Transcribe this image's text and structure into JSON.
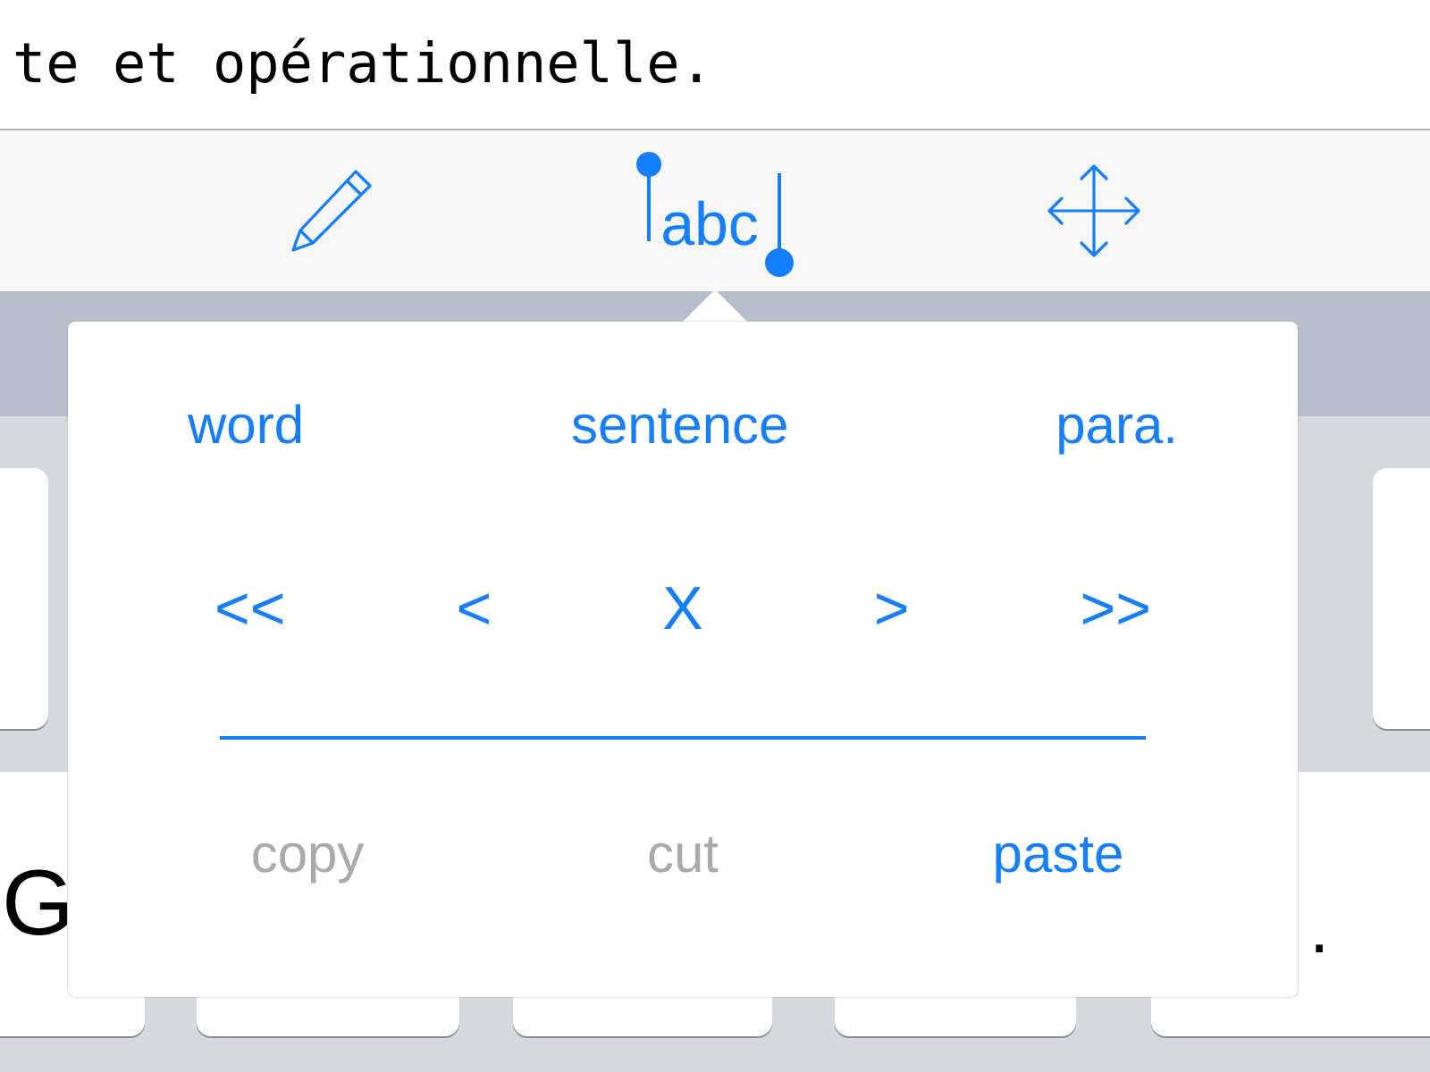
{
  "document": {
    "text": "te et opérationnelle."
  },
  "toolbar": {
    "tools": [
      {
        "kind": "pencil",
        "selected": false
      },
      {
        "kind": "selection",
        "label": "abc",
        "selected": true
      },
      {
        "kind": "move",
        "selected": false
      }
    ]
  },
  "popover": {
    "units": [
      "word",
      "sentence",
      "para."
    ],
    "navigation": [
      "<<",
      "<",
      "X",
      ">",
      ">>"
    ],
    "actions": [
      {
        "label": "copy",
        "disabled": true
      },
      {
        "label": "cut",
        "disabled": true
      },
      {
        "label": "paste",
        "disabled": false
      }
    ]
  },
  "keyboard": {
    "left_key": "G",
    "right_key": "."
  }
}
